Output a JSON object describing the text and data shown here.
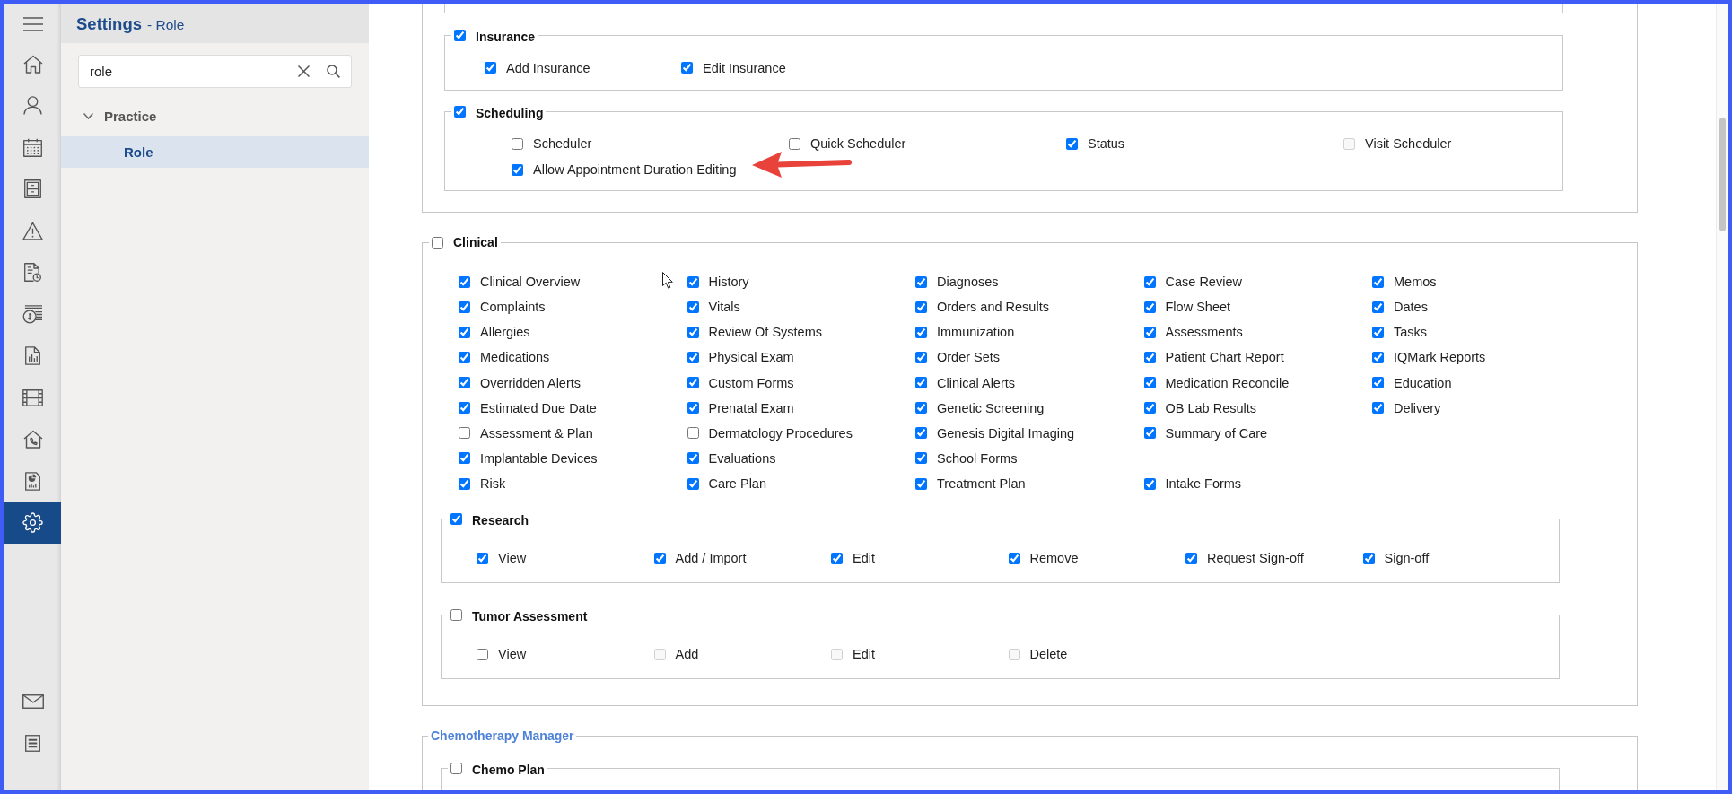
{
  "nav": {
    "items": [
      {
        "selected": false
      },
      {
        "selected": false
      },
      {
        "selected": false
      },
      {
        "selected": false
      },
      {
        "selected": false
      },
      {
        "selected": false
      },
      {
        "selected": false
      },
      {
        "selected": false
      },
      {
        "selected": false
      },
      {
        "selected": false
      },
      {
        "selected": false
      },
      {
        "selected": true
      }
    ],
    "bottom_items": [
      {
        "selected": false
      },
      {
        "selected": false
      }
    ]
  },
  "sidebar": {
    "title": "Settings",
    "subtitle": "- Role",
    "search": {
      "value": "role"
    },
    "tree": [
      {
        "label": "Practice",
        "expanded": true,
        "selected": false,
        "children": [
          {
            "label": "Role",
            "selected": true
          }
        ]
      }
    ]
  },
  "sections": [
    {
      "kind": "cropped",
      "groups": [
        {
          "kind": "cropped"
        },
        {
          "kind": "group",
          "label": "Insurance",
          "checked": true,
          "items": [
            {
              "label": "Add Insurance",
              "checked": true
            },
            {
              "label": "Edit Insurance",
              "checked": true
            }
          ]
        },
        {
          "kind": "group",
          "label": "Scheduling",
          "checked": true,
          "items": [
            {
              "label": "Scheduler",
              "checked": false,
              "disabled": false
            },
            {
              "label": "Quick Scheduler",
              "checked": false,
              "disabled": false
            },
            {
              "label": "Status",
              "checked": true,
              "disabled": false
            },
            {
              "label": "Visit Scheduler",
              "checked": false,
              "disabled": true
            },
            {
              "label": "Allow Appointment Duration Editing",
              "checked": true,
              "disabled": false
            }
          ]
        }
      ]
    },
    {
      "kind": "checkbox",
      "label": "Clinical",
      "checked": false,
      "rows": [
        [
          {
            "label": "Clinical Overview",
            "checked": true
          },
          {
            "label": "History",
            "checked": true
          },
          {
            "label": "Diagnoses",
            "checked": true
          },
          {
            "label": "Case Review",
            "checked": true
          },
          {
            "label": "Memos",
            "checked": true
          }
        ],
        [
          {
            "label": "Complaints",
            "checked": true
          },
          {
            "label": "Vitals",
            "checked": true
          },
          {
            "label": "Orders and Results",
            "checked": true
          },
          {
            "label": "Flow Sheet",
            "checked": true
          },
          {
            "label": "Dates",
            "checked": true
          }
        ],
        [
          {
            "label": "Allergies",
            "checked": true
          },
          {
            "label": "Review Of Systems",
            "checked": true
          },
          {
            "label": "Immunization",
            "checked": true
          },
          {
            "label": "Assessments",
            "checked": true
          },
          {
            "label": "Tasks",
            "checked": true
          }
        ],
        [
          {
            "label": "Medications",
            "checked": true
          },
          {
            "label": "Physical Exam",
            "checked": true
          },
          {
            "label": "Order Sets",
            "checked": true
          },
          {
            "label": "Patient Chart Report",
            "checked": true
          },
          {
            "label": "IQMark Reports",
            "checked": true
          }
        ],
        [
          {
            "label": "Overridden Alerts",
            "checked": true
          },
          {
            "label": "Custom Forms",
            "checked": true
          },
          {
            "label": "Clinical Alerts",
            "checked": true
          },
          {
            "label": "Medication Reconcile",
            "checked": true
          },
          {
            "label": "Education",
            "checked": true
          }
        ],
        [
          {
            "label": "Estimated Due Date",
            "checked": true
          },
          {
            "label": "Prenatal Exam",
            "checked": true
          },
          {
            "label": "Genetic Screening",
            "checked": true
          },
          {
            "label": "OB Lab Results",
            "checked": true
          },
          {
            "label": "Delivery",
            "checked": true
          }
        ],
        [
          {
            "label": "Assessment & Plan",
            "checked": false
          },
          {
            "label": "Dermatology Procedures",
            "checked": false
          },
          {
            "label": "Genesis Digital Imaging",
            "checked": true
          },
          {
            "label": "Summary of Care",
            "checked": true
          }
        ],
        [
          {
            "label": "Implantable Devices",
            "checked": true
          },
          {
            "label": "Evaluations",
            "checked": true
          },
          {
            "label": "School Forms",
            "checked": true
          }
        ],
        [
          {
            "label": "Risk",
            "checked": true
          },
          {
            "label": "Care Plan",
            "checked": true
          },
          {
            "label": "Treatment Plan",
            "checked": true
          },
          {
            "label": "Intake Forms",
            "checked": true
          }
        ]
      ],
      "groups": [
        {
          "kind": "group",
          "label": "Research",
          "checked": true,
          "items": [
            {
              "label": "View",
              "checked": true
            },
            {
              "label": "Add / Import",
              "checked": true
            },
            {
              "label": "Edit",
              "checked": true
            },
            {
              "label": "Remove",
              "checked": true
            },
            {
              "label": "Request Sign-off",
              "checked": true
            },
            {
              "label": "Sign-off",
              "checked": true
            }
          ]
        },
        {
          "kind": "group",
          "label": "Tumor Assessment",
          "checked": false,
          "items": [
            {
              "label": "View",
              "checked": false,
              "disabled": false
            },
            {
              "label": "Add",
              "checked": false,
              "disabled": true
            },
            {
              "label": "Edit",
              "checked": false,
              "disabled": true
            },
            {
              "label": "Delete",
              "checked": false,
              "disabled": true
            }
          ]
        }
      ]
    },
    {
      "kind": "title",
      "label": "Chemotherapy Manager",
      "groups": [
        {
          "kind": "group",
          "label": "Chemo Plan",
          "checked": false
        }
      ]
    }
  ]
}
